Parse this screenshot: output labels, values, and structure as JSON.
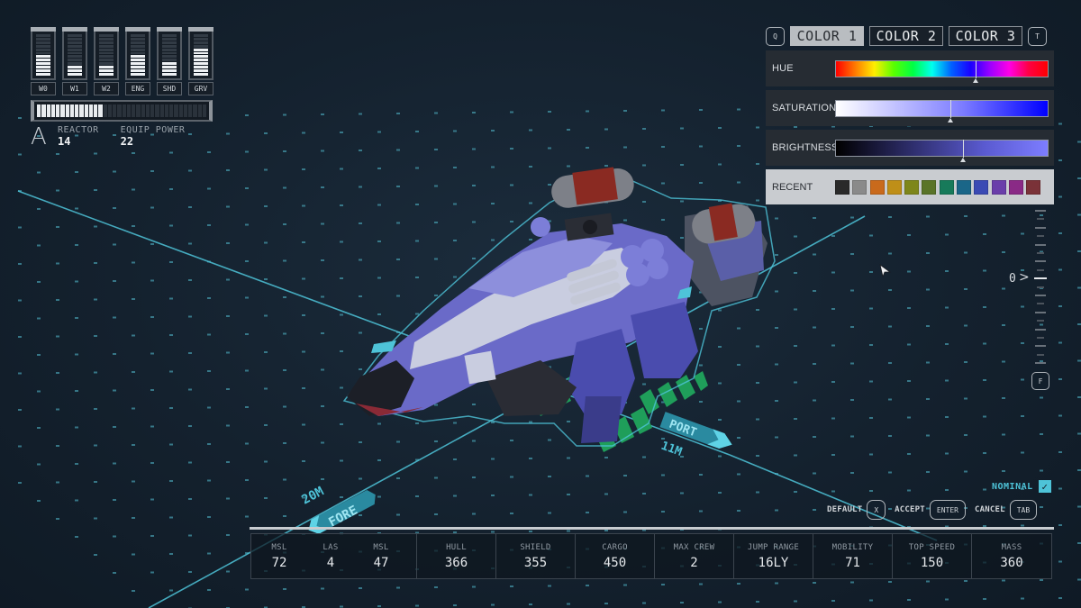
{
  "power": {
    "segments_per_bar": 12,
    "systems": [
      {
        "label": "W0",
        "level": 6
      },
      {
        "label": "W1",
        "level": 3
      },
      {
        "label": "W2",
        "level": 3
      },
      {
        "label": "ENG",
        "level": 6
      },
      {
        "label": "SHD",
        "level": 4
      },
      {
        "label": "GRV",
        "level": 8
      }
    ],
    "reactor_bar": {
      "lit": 14,
      "total": 36
    },
    "reactor_class": "A",
    "reactor_label": "REACTOR",
    "reactor_value": "14",
    "equip_power_label": "EQUIP POWER",
    "equip_power_value": "22"
  },
  "color_panel": {
    "prev_key": "Q",
    "next_key": "T",
    "tabs": [
      {
        "label": "COLOR 1",
        "active": true
      },
      {
        "label": "COLOR 2",
        "active": false
      },
      {
        "label": "COLOR 3",
        "active": false
      }
    ],
    "sliders": [
      {
        "label": "HUE",
        "kind": "hue",
        "value_pct": 66
      },
      {
        "label": "SATURATION",
        "kind": "sat",
        "value_pct": 54
      },
      {
        "label": "BRIGHTNESS",
        "kind": "bri",
        "value_pct": 60
      }
    ],
    "recent_label": "RECENT",
    "recent_colors": [
      "#2a2a2a",
      "#8a8a8a",
      "#c96a1c",
      "#bf8f18",
      "#7e861a",
      "#5a7428",
      "#177a5a",
      "#1a6688",
      "#3a4ab4",
      "#6a3eaa",
      "#8a2a86",
      "#7a3238"
    ]
  },
  "zoom_scale": {
    "value": "0",
    "key": "F"
  },
  "status": {
    "label": "NOMINAL",
    "check": "✓"
  },
  "actions": [
    {
      "label": "DEFAULT",
      "key": "X"
    },
    {
      "label": "ACCEPT",
      "key": "ENTER"
    },
    {
      "label": "CANCEL",
      "key": "TAB"
    }
  ],
  "ground": {
    "fore_label": "FORE",
    "port_label": "PORT",
    "fore_distance": "20M",
    "port_distance": "11M"
  },
  "stats": {
    "weapons": [
      {
        "label": "MSL",
        "value": "72"
      },
      {
        "label": "LAS",
        "value": "4"
      },
      {
        "label": "MSL",
        "value": "47"
      }
    ],
    "items": [
      {
        "label": "HULL",
        "value": "366"
      },
      {
        "label": "SHIELD",
        "value": "355"
      },
      {
        "label": "CARGO",
        "value": "450"
      },
      {
        "label": "MAX CREW",
        "value": "2"
      },
      {
        "label": "JUMP RANGE",
        "value": "16LY"
      },
      {
        "label": "MOBILITY",
        "value": "71"
      },
      {
        "label": "TOP SPEED",
        "value": "150"
      },
      {
        "label": "MASS",
        "value": "360"
      }
    ]
  },
  "colors": {
    "accent": "#4ec3d8",
    "background": "#14212e",
    "landing_stripes": "#1f9e5a",
    "ship_primary": "#6a6ac8",
    "ship_secondary": "#c9cde0",
    "fuel_tank_red": "#8a2a22"
  }
}
